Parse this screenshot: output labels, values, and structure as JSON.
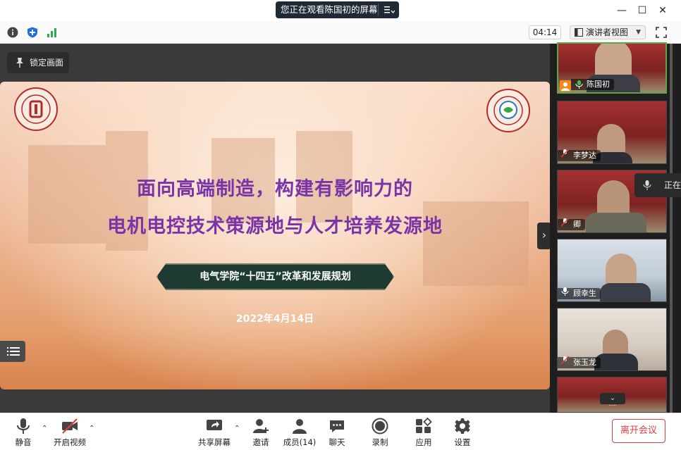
{
  "window": {
    "viewing_banner": "您正在观看陈国初的屏幕",
    "minimize": "—",
    "maximize": "☐",
    "close": "✕"
  },
  "toolbar": {
    "timer": "04:14",
    "view_mode": "演讲者视图"
  },
  "share": {
    "lock_label": "锁定画面"
  },
  "slide": {
    "title_line1": "面向高端制造，构建有影响力的",
    "title_line2": "电机电控技术策源地与人才培养发源地",
    "banner": "电气学院“十四五”改革和发展规划",
    "date": "2022年4月14日"
  },
  "participants": [
    {
      "name": "陈国初",
      "active": true,
      "muted": false
    },
    {
      "name": "李梦达",
      "active": false,
      "muted": true
    },
    {
      "name": "卿",
      "active": false,
      "muted": true
    },
    {
      "name": "顾幸生",
      "active": false,
      "muted": false
    },
    {
      "name": "张玉龙",
      "active": false,
      "muted": true
    }
  ],
  "talking_tag": "正在",
  "controls": {
    "mute": "静音",
    "video": "开启视频",
    "share": "共享屏幕",
    "invite": "邀请",
    "members": "成员(14)",
    "chat": "聊天",
    "record": "录制",
    "apps": "应用",
    "settings": "设置",
    "leave": "离开会议"
  },
  "colors": {
    "accent_green": "#5fa34a",
    "leave_red": "#e03c3c",
    "slide_title_purple": "#7a34a8",
    "banner_dark": "#1d3b33"
  }
}
